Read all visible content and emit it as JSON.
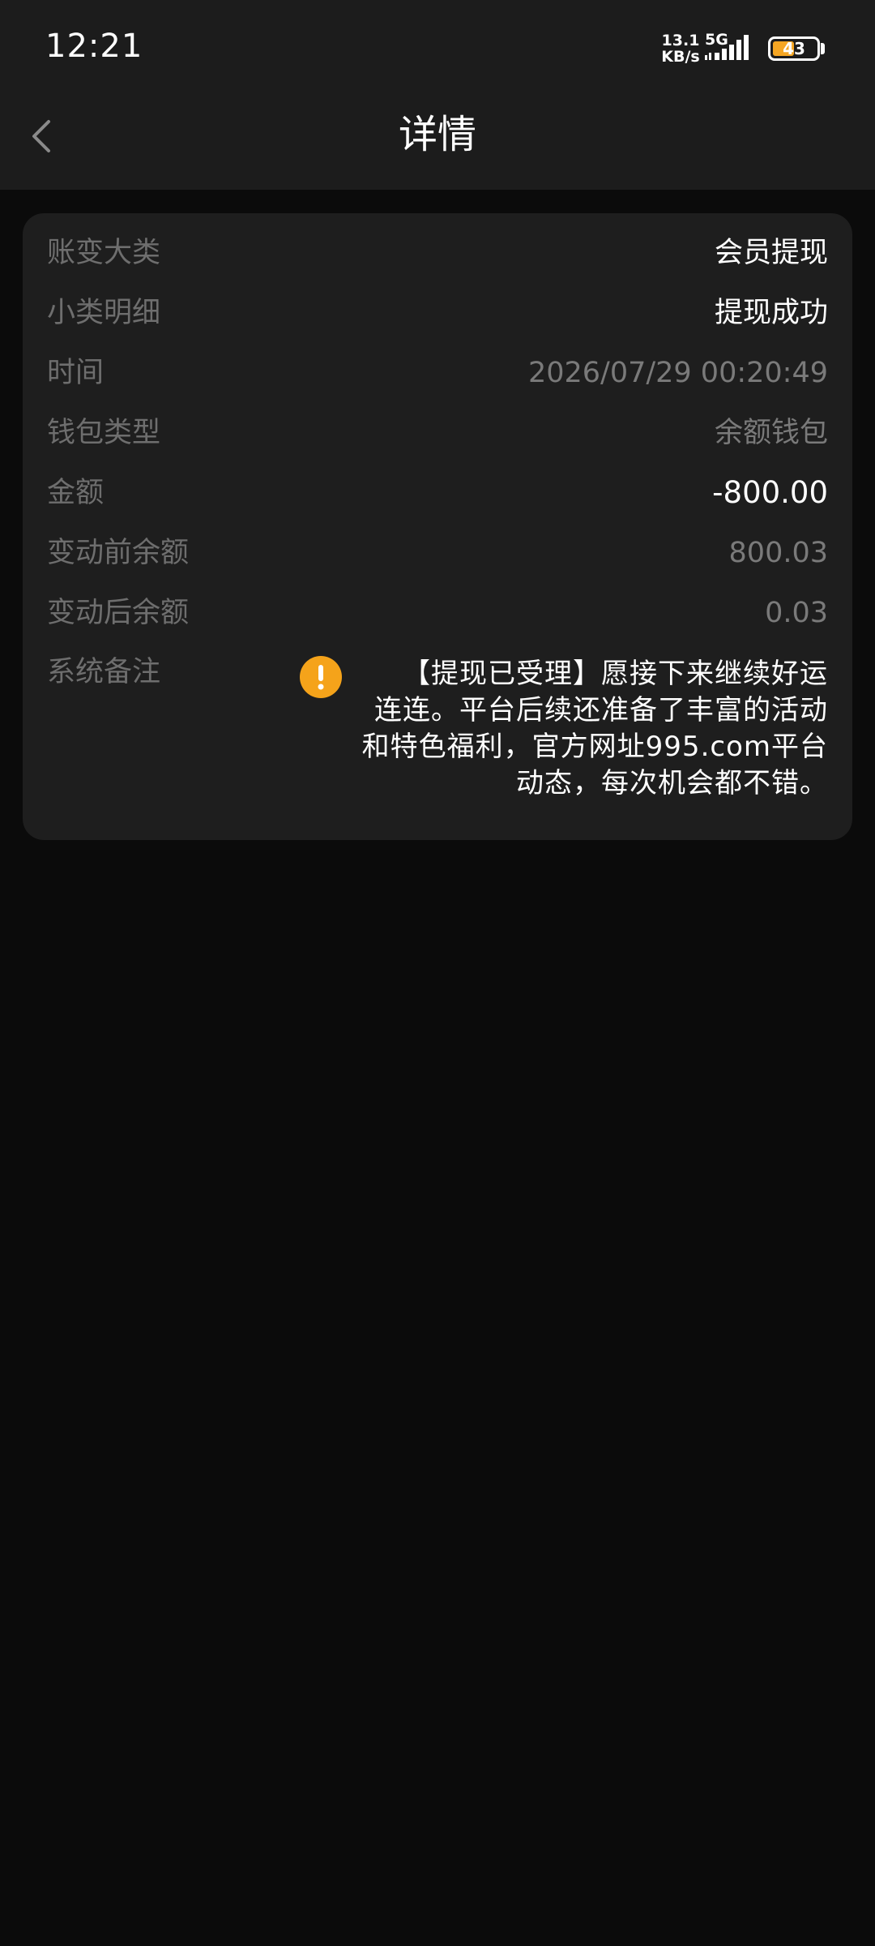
{
  "status_bar": {
    "time": "12:21",
    "net_speed_value": "13.1",
    "net_speed_unit": "KB/s",
    "network_type": "5G",
    "battery_level": "43",
    "signal_icon": "signal-bars-icon",
    "battery_icon": "battery-icon"
  },
  "header": {
    "title": "详情",
    "back_icon": "chevron-left-icon"
  },
  "details": {
    "rows": [
      {
        "label": "账变大类",
        "value": "会员提现"
      },
      {
        "label": "小类明细",
        "value": "提现成功"
      },
      {
        "label": "时间",
        "value": "2026/07/29 00:20:49"
      },
      {
        "label": "钱包类型",
        "value": "余额钱包"
      },
      {
        "label": "金额",
        "value": "-800.00"
      },
      {
        "label": "变动前余额",
        "value": "800.03"
      },
      {
        "label": "变动后余额",
        "value": "0.03"
      }
    ],
    "remark_label": "系统备注",
    "remark_icon": "warning-icon",
    "remark_text": "【提现已受理】愿接下来继续好运连连。平台后续还准备了丰富的活动和特色福利，官方网址995.com平台动态，每次机会都不错。"
  },
  "colors": {
    "background": "#0b0b0b",
    "header_bg": "#1c1c1c",
    "card_bg": "#1e1e1e",
    "label_gray": "#6e6e6e",
    "warning_orange": "#f5a31a",
    "battery_fill": "#f5a623"
  }
}
